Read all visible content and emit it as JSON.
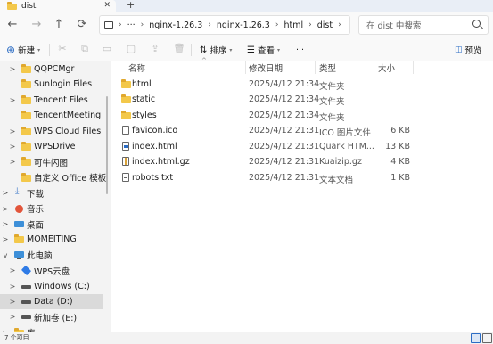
{
  "tab": {
    "title": "dist",
    "close_glyph": "✕",
    "new_glyph": "+"
  },
  "nav": {
    "back": "←",
    "forward": "→",
    "up": "↑",
    "refresh": "⟳"
  },
  "address": {
    "ellipsis": "···",
    "sep": "›",
    "crumbs": [
      "nginx-1.26.3",
      "nginx-1.26.3",
      "html",
      "dist"
    ]
  },
  "search": {
    "placeholder": "在 dist 中搜索"
  },
  "toolbar": {
    "new_label": "新建",
    "sort_label": "排序",
    "view_label": "查看",
    "more_label": "···",
    "preview_label": "预览"
  },
  "sidebar": {
    "items": [
      {
        "label": "QQPCMgr",
        "chev": ">",
        "icon": "folder"
      },
      {
        "label": "Sunlogin Files",
        "chev": "",
        "icon": "folder"
      },
      {
        "label": "Tencent Files",
        "chev": ">",
        "icon": "folder"
      },
      {
        "label": "TencentMeeting",
        "chev": "",
        "icon": "folder"
      },
      {
        "label": "WPS Cloud Files",
        "chev": ">",
        "icon": "folder"
      },
      {
        "label": "WPSDrive",
        "chev": ">",
        "icon": "folder"
      },
      {
        "label": "可牛闪图",
        "chev": ">",
        "icon": "folder"
      },
      {
        "label": "自定义 Office 模板",
        "chev": "",
        "icon": "folder"
      },
      {
        "label": "下载",
        "chev": ">",
        "icon": "download"
      },
      {
        "label": "音乐",
        "chev": ">",
        "icon": "music"
      },
      {
        "label": "桌面",
        "chev": ">",
        "icon": "desktop"
      },
      {
        "label": "MOMEITING",
        "chev": ">",
        "icon": "folder"
      },
      {
        "label": "此电脑",
        "chev": "v",
        "icon": "pc"
      },
      {
        "label": "WPS云盘",
        "chev": ">",
        "icon": "cloud"
      },
      {
        "label": "Windows (C:)",
        "chev": ">",
        "icon": "drive"
      },
      {
        "label": "Data (D:)",
        "chev": ">",
        "icon": "drive"
      },
      {
        "label": "新加卷 (E:)",
        "chev": ">",
        "icon": "drive"
      },
      {
        "label": "库",
        "chev": ">",
        "icon": "folder"
      }
    ]
  },
  "columns": {
    "name": "名称",
    "date": "修改日期",
    "type": "类型",
    "size": "大小"
  },
  "files": [
    {
      "name": "html",
      "date": "2025/4/12 21:34",
      "type": "文件夹",
      "size": "",
      "icon": "folder"
    },
    {
      "name": "static",
      "date": "2025/4/12 21:34",
      "type": "文件夹",
      "size": "",
      "icon": "folder"
    },
    {
      "name": "styles",
      "date": "2025/4/12 21:34",
      "type": "文件夹",
      "size": "",
      "icon": "folder"
    },
    {
      "name": "favicon.ico",
      "date": "2025/4/12 21:31",
      "type": "ICO 图片文件",
      "size": "6 KB",
      "icon": "ico-file"
    },
    {
      "name": "index.html",
      "date": "2025/4/12 21:31",
      "type": "Quark HTM...",
      "size": "13 KB",
      "icon": "html-file"
    },
    {
      "name": "index.html.gz",
      "date": "2025/4/12 21:31",
      "type": "Kuaizip.gz",
      "size": "4 KB",
      "icon": "archive-file"
    },
    {
      "name": "robots.txt",
      "date": "2025/4/12 21:31",
      "type": "文本文档",
      "size": "1 KB",
      "icon": "text-file"
    }
  ],
  "status": {
    "count": "7 个项目"
  },
  "colors": {
    "folder": "#f3c84a",
    "accent": "#2b6cc4",
    "selected": "#dadada"
  }
}
